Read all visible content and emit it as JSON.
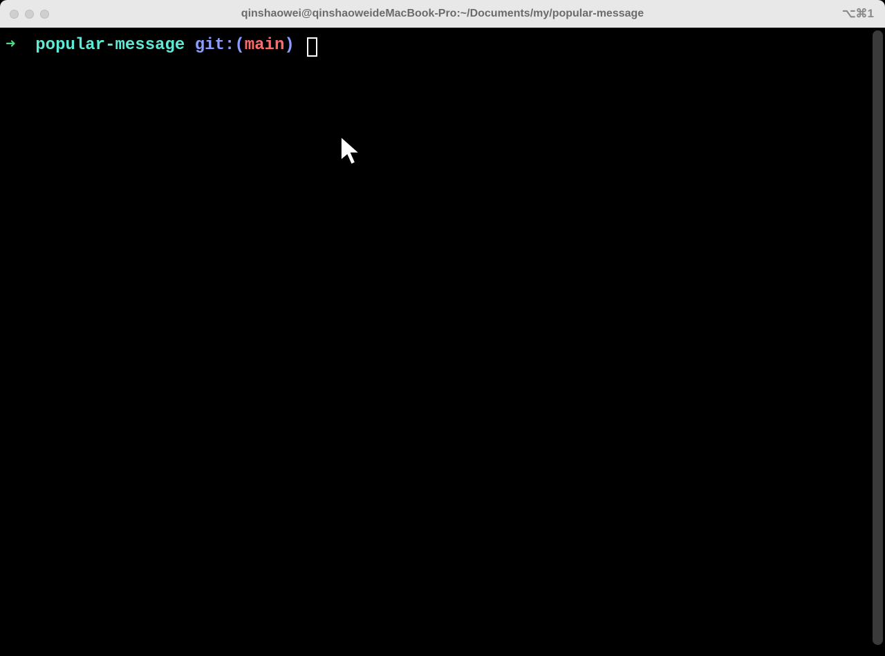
{
  "titlebar": {
    "title": "qinshaowei@qinshaoweideMacBook-Pro:~/Documents/my/popular-message",
    "shortcut": "⌥⌘1"
  },
  "prompt": {
    "arrow": "➜",
    "directory": "popular-message",
    "git_label": "git:",
    "paren_open": "(",
    "branch": "main",
    "paren_close": ")"
  },
  "spacing": {
    "after_arrow": "  ",
    "before_git": " ",
    "after_close": " "
  }
}
